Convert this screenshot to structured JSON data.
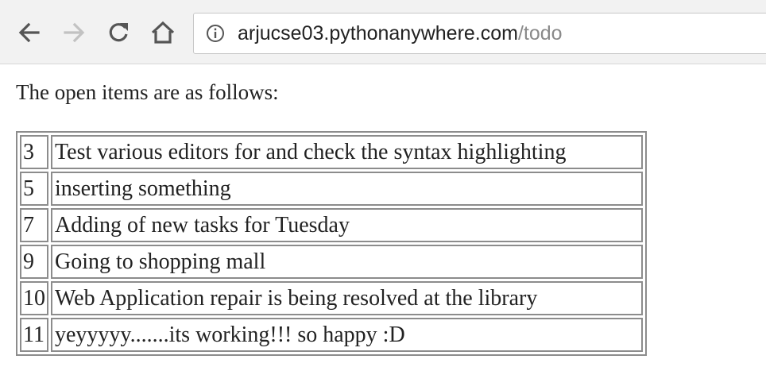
{
  "browser": {
    "url_host": "arjucse03.pythonanywhere.com",
    "url_path": "/todo",
    "icons": {
      "back": "arrow-left-icon",
      "forward": "arrow-right-icon",
      "reload": "reload-icon",
      "home": "home-icon",
      "info": "info-circle-icon"
    }
  },
  "page": {
    "intro_text": "The open items are as follows:",
    "todos": [
      {
        "id": "3",
        "task": "Test various editors for and check the syntax highlighting"
      },
      {
        "id": "5",
        "task": "inserting something"
      },
      {
        "id": "7",
        "task": "Adding of new tasks for Tuesday"
      },
      {
        "id": "9",
        "task": "Going to shopping mall"
      },
      {
        "id": "10",
        "task": "Web Application repair is being resolved at the library"
      },
      {
        "id": "11",
        "task": "yeyyyyy.......its working!!! so happy :D"
      }
    ]
  }
}
